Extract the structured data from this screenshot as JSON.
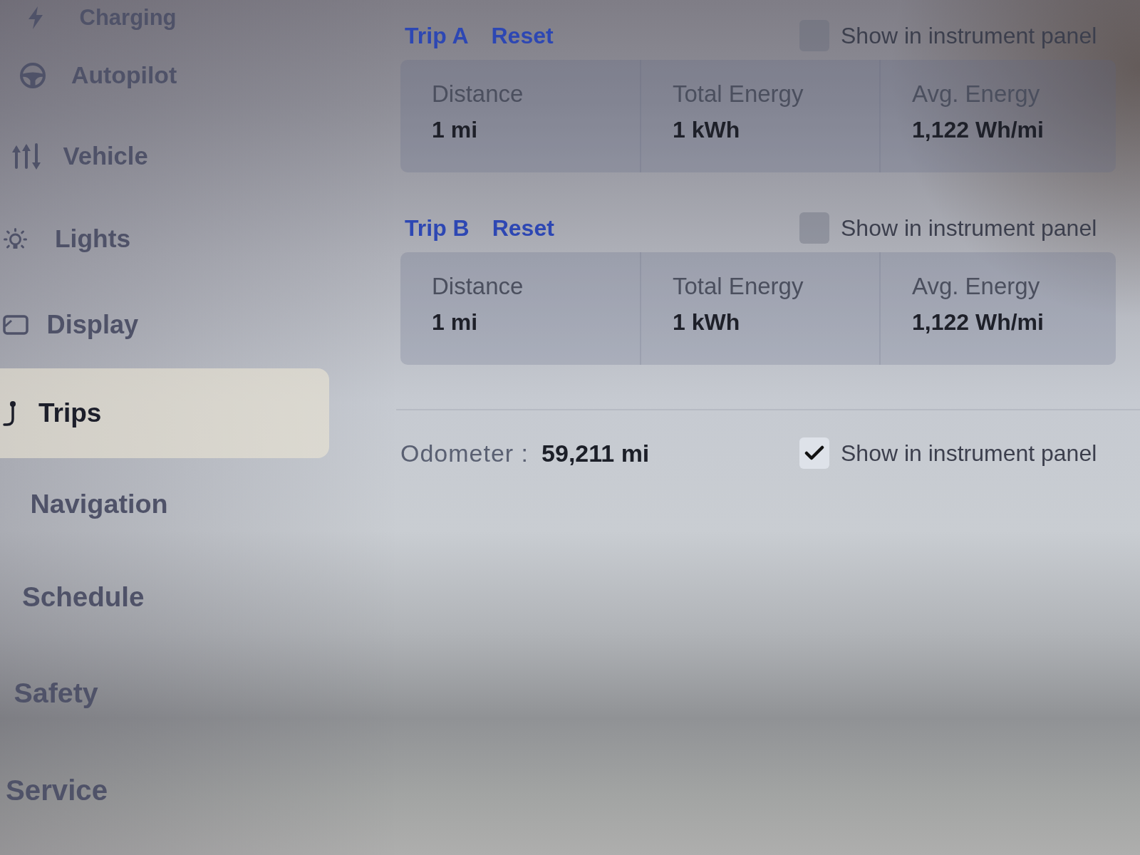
{
  "sidebar": {
    "items": [
      {
        "label": "Charging",
        "selected": false
      },
      {
        "label": "Autopilot",
        "selected": false
      },
      {
        "label": "Vehicle",
        "selected": false
      },
      {
        "label": "Lights",
        "selected": false
      },
      {
        "label": "Display",
        "selected": false
      },
      {
        "label": "Trips",
        "selected": true
      },
      {
        "label": "Navigation",
        "selected": false
      },
      {
        "label": "Schedule",
        "selected": false
      },
      {
        "label": "Safety",
        "selected": false
      },
      {
        "label": "Service",
        "selected": false
      }
    ]
  },
  "trips": [
    {
      "title": "Trip A",
      "reset_button": "Reset",
      "show_in_panel": {
        "label": "Show in instrument panel",
        "checked": false
      },
      "stats": [
        {
          "label": "Distance",
          "value": "1 mi"
        },
        {
          "label": "Total Energy",
          "value": "1 kWh"
        },
        {
          "label": "Avg. Energy",
          "value": "1,122 Wh/mi"
        }
      ]
    },
    {
      "title": "Trip B",
      "reset_button": "Reset",
      "show_in_panel": {
        "label": "Show in instrument panel",
        "checked": false
      },
      "stats": [
        {
          "label": "Distance",
          "value": "1 mi"
        },
        {
          "label": "Total Energy",
          "value": "1 kWh"
        },
        {
          "label": "Avg. Energy",
          "value": "1,122 Wh/mi"
        }
      ]
    }
  ],
  "odometer": {
    "label": "Odometer :",
    "value": "59,211 mi",
    "show_in_panel": {
      "label": "Show in instrument panel",
      "checked": true
    }
  }
}
